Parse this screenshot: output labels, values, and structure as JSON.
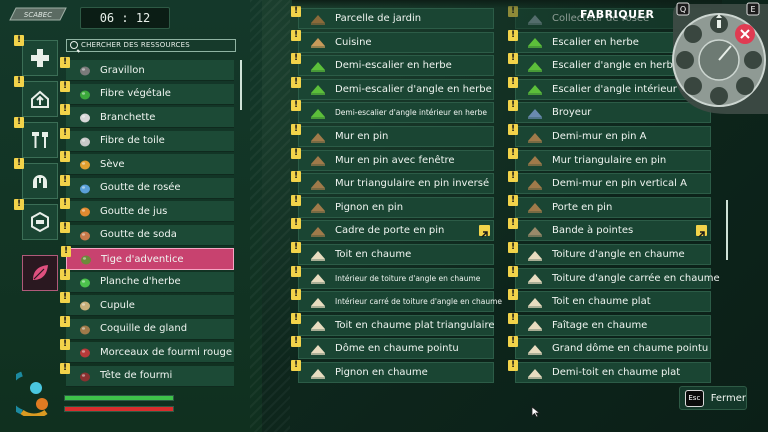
{
  "header": {
    "logo_text": "SCABEC",
    "timer": "06 : 12",
    "panel_title": "FABRIQUER"
  },
  "categories": [
    {
      "name": "building",
      "icon": "plus-cross-icon",
      "has_alert": true
    },
    {
      "name": "base",
      "icon": "house-up-icon",
      "has_alert": true
    },
    {
      "name": "tools",
      "icon": "hammer-tools-icon",
      "has_alert": true
    },
    {
      "name": "armor",
      "icon": "helmet-icon",
      "has_alert": true
    },
    {
      "name": "trinkets",
      "icon": "hexagon-icon",
      "has_alert": true
    },
    {
      "name": "resources",
      "icon": "leaf-icon",
      "has_alert": false,
      "active": true
    }
  ],
  "resources": {
    "search_placeholder": "CHERCHER DES RESSOURCES",
    "items": [
      {
        "label": "Gravillon",
        "icon": "pebble-icon",
        "alert": true
      },
      {
        "label": "Fibre végétale",
        "icon": "plant-fiber-icon",
        "alert": true
      },
      {
        "label": "Branchette",
        "icon": "twig-icon",
        "alert": true
      },
      {
        "label": "Fibre de toile",
        "icon": "web-fiber-icon",
        "alert": true
      },
      {
        "label": "Sève",
        "icon": "sap-icon",
        "alert": true
      },
      {
        "label": "Goutte de rosée",
        "icon": "dew-drop-icon",
        "alert": true
      },
      {
        "label": "Goutte de jus",
        "icon": "juice-drop-icon",
        "alert": true
      },
      {
        "label": "Goutte de soda",
        "icon": "soda-drop-icon",
        "alert": true
      },
      {
        "label": "Tige d'adventice",
        "icon": "weed-stem-icon",
        "alert": true,
        "selected": true
      },
      {
        "label": "Planche d'herbe",
        "icon": "grass-plank-icon",
        "alert": true
      },
      {
        "label": "Cupule",
        "icon": "acorn-cap-icon",
        "alert": true
      },
      {
        "label": "Coquille de gland",
        "icon": "acorn-shell-icon",
        "alert": true
      },
      {
        "label": "Morceaux de fourmi rouge",
        "icon": "red-ant-part-icon",
        "alert": true
      },
      {
        "label": "Tête de fourmi",
        "icon": "ant-head-icon",
        "alert": true
      }
    ]
  },
  "recipes_left": [
    {
      "label": "Parcelle de jardin",
      "icon": "garden-plot-icon",
      "small": false
    },
    {
      "label": "Cuisine",
      "icon": "kitchen-icon",
      "small": false
    },
    {
      "label": "Demi-escalier en herbe",
      "icon": "grass-half-stair-icon",
      "small": false
    },
    {
      "label": "Demi-escalier d'angle en herbe",
      "icon": "grass-corner-half-stair-icon",
      "small": false
    },
    {
      "label": "Demi-escalier d'angle intérieur en herbe",
      "icon": "grass-inner-corner-half-stair-icon",
      "small": true
    },
    {
      "label": "Mur en pin",
      "icon": "pine-wall-icon",
      "small": false
    },
    {
      "label": "Mur en pin avec fenêtre",
      "icon": "pine-window-wall-icon",
      "small": false
    },
    {
      "label": "Mur triangulaire en pin inversé",
      "icon": "pine-inverted-triangle-wall-icon",
      "small": false
    },
    {
      "label": "Pignon en pin",
      "icon": "pine-gable-icon",
      "small": false
    },
    {
      "label": "Cadre de porte en pin",
      "icon": "pine-door-frame-icon",
      "small": false,
      "upgrade": true
    },
    {
      "label": "Toit en chaume",
      "icon": "thatch-roof-icon",
      "small": false
    },
    {
      "label": "Intérieur de toiture d'angle en chaume",
      "icon": "thatch-inner-corner-roof-icon",
      "small": true
    },
    {
      "label": "Intérieur carré de toiture d'angle en chaume",
      "icon": "thatch-square-inner-corner-icon",
      "small": true
    },
    {
      "label": "Toit en chaume plat triangulaire",
      "icon": "thatch-flat-triangle-roof-icon",
      "small": false
    },
    {
      "label": "Dôme en chaume pointu",
      "icon": "thatch-pointed-dome-icon",
      "small": false
    },
    {
      "label": "Pignon en chaume",
      "icon": "thatch-gable-icon",
      "small": false
    }
  ],
  "recipes_right": [
    {
      "label": "Collecteur de rosée",
      "icon": "dew-collector-icon",
      "small": false,
      "faded": true
    },
    {
      "label": "Escalier en herbe",
      "icon": "grass-stair-icon",
      "small": false
    },
    {
      "label": "Escalier d'angle en herbe",
      "icon": "grass-corner-stair-icon",
      "small": false
    },
    {
      "label": "Escalier d'angle intérieur en herbe",
      "icon": "grass-inner-corner-stair-icon",
      "small": false
    },
    {
      "label": "Broyeur",
      "icon": "grinder-icon",
      "small": false
    },
    {
      "label": "Demi-mur en pin A",
      "icon": "pine-half-wall-a-icon",
      "small": false
    },
    {
      "label": "Mur triangulaire en pin",
      "icon": "pine-triangle-wall-icon",
      "small": false
    },
    {
      "label": "Demi-mur en pin vertical A",
      "icon": "pine-vertical-half-wall-icon",
      "small": false
    },
    {
      "label": "Porte en pin",
      "icon": "pine-door-icon",
      "small": false
    },
    {
      "label": "Bande à pointes",
      "icon": "spike-strip-icon",
      "small": false,
      "upgrade": true
    },
    {
      "label": "Toiture d'angle en chaume",
      "icon": "thatch-corner-roof-icon",
      "small": false
    },
    {
      "label": "Toiture d'angle carrée en chaume",
      "icon": "thatch-square-corner-roof-icon",
      "small": false
    },
    {
      "label": "Toit en chaume plat",
      "icon": "thatch-flat-roof-icon",
      "small": false
    },
    {
      "label": "Faîtage en chaume",
      "icon": "thatch-ridge-icon",
      "small": false
    },
    {
      "label": "Grand dôme en chaume pointu",
      "icon": "thatch-large-dome-icon",
      "small": false
    },
    {
      "label": "Demi-toit en chaume plat",
      "icon": "thatch-half-flat-roof-icon",
      "small": false
    }
  ],
  "wheel": {
    "key_left": "Q",
    "key_right": "E",
    "active_tool": "crafting-hammer-icon"
  },
  "status": {
    "health_fraction": 1.0,
    "stamina_fraction": 1.0
  },
  "footer": {
    "esc_key": "Esc",
    "close_label": "Fermer"
  }
}
